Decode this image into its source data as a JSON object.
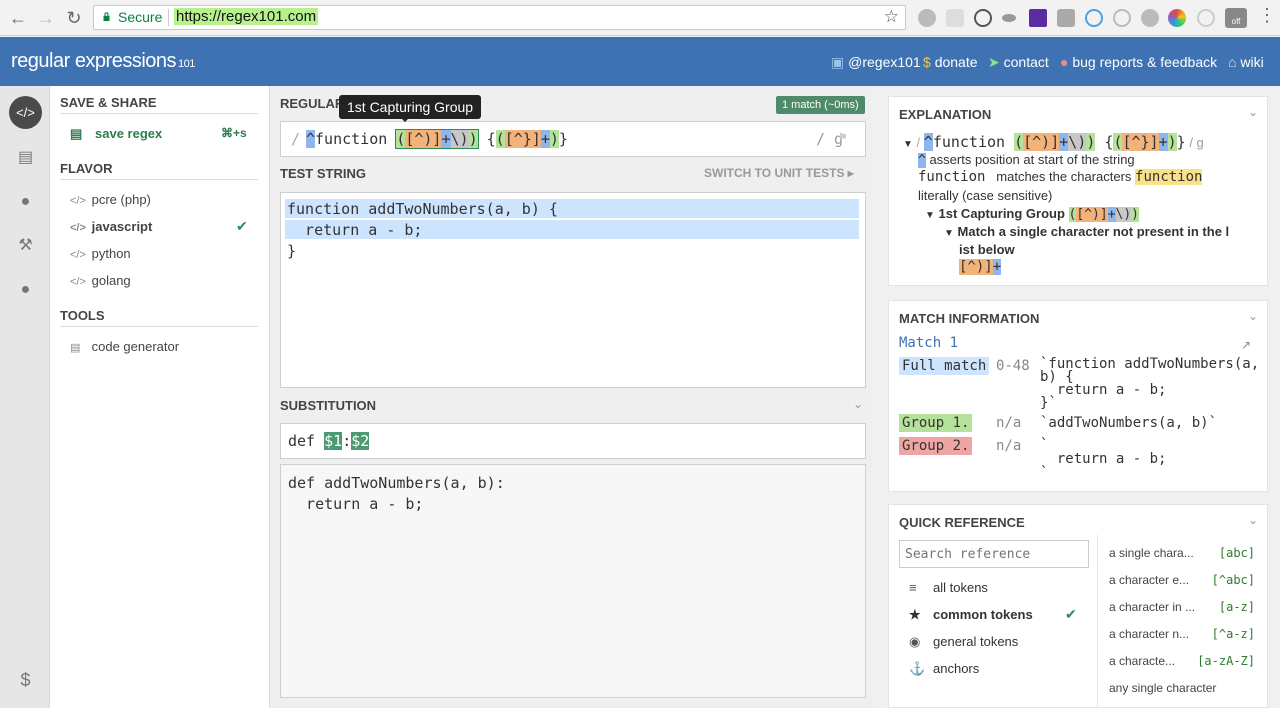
{
  "browser": {
    "secure_label": "Secure",
    "url": "https://regex101.com",
    "ext_off_label": "off"
  },
  "header": {
    "logo": "regular expressions",
    "logo_suffix": "101",
    "links": [
      "@regex101",
      "donate",
      "contact",
      "bug reports & feedback",
      "wiki"
    ]
  },
  "sidebar": {
    "save_share": "SAVE & SHARE",
    "save_regex": "save regex",
    "save_shortcut": "⌘+s",
    "flavor": "FLAVOR",
    "flavors": [
      "pcre (php)",
      "javascript",
      "python",
      "golang"
    ],
    "tools": "TOOLS",
    "code_generator": "code generator"
  },
  "regex": {
    "label": "REGULAR EXPRESSION",
    "tooltip": "1st Capturing Group",
    "match_badge": "1 match (~0ms)",
    "delimiter_open": "/",
    "flags": "/ g",
    "caret": "^",
    "literal": "function",
    "g1_open": "(",
    "cls": "[^)]",
    "plus": "+",
    "esc": "\\)",
    "g1_close": ")",
    "brace_open": "{",
    "g2_open": "(",
    "cls2": "[^}]",
    "plus2": "+",
    "g2_close": ")",
    "brace_close": "}"
  },
  "test": {
    "label": "TEST STRING",
    "unit_tests": "SWITCH TO UNIT TESTS",
    "lines": [
      "function addTwoNumbers(a, b) {",
      "  return a - b;",
      "}"
    ]
  },
  "subst": {
    "label": "SUBSTITUTION",
    "def": "def",
    "g1": "$1",
    "colon": ":",
    "g2": "$2",
    "result_lines": [
      "def addTwoNumbers(a, b):",
      "  return a - b;"
    ]
  },
  "explanation": {
    "title": "EXPLANATION",
    "top_flags": "/ g",
    "lines": {
      "caret_desc": "asserts position at start of the string",
      "function_token": "function",
      "function_desc": "matches the characters",
      "function_hl": "function",
      "literal_desc": "literally (case sensitive)",
      "group1": "1st Capturing Group",
      "match_single": "Match a single character not present in the l",
      "match_single2": "ist below",
      "cls_hl": "[^)]+"
    }
  },
  "match_info": {
    "title": "MATCH INFORMATION",
    "match_label": "Match 1",
    "rows": [
      {
        "name": "Full match",
        "range": "0-48",
        "value1": "`function addTwoNumbers(a,",
        "value2": "b) {",
        "value3": "  return a - b;",
        "value4": "}`"
      },
      {
        "name": "Group 1.",
        "range": "n/a",
        "value1": "`addTwoNumbers(a, b)`"
      },
      {
        "name": "Group 2.",
        "range": "n/a",
        "value1": "`",
        "value2": "  return a - b;",
        "value3": "`"
      }
    ]
  },
  "quick_ref": {
    "title": "QUICK REFERENCE",
    "search_placeholder": "Search reference",
    "categories": [
      "all tokens",
      "common tokens",
      "general tokens",
      "anchors"
    ],
    "refs": [
      {
        "desc": "a single chara...",
        "tok": "[abc]"
      },
      {
        "desc": "a character e...",
        "tok": "[^abc]"
      },
      {
        "desc": "a character in ...",
        "tok": "[a-z]"
      },
      {
        "desc": "a character n...",
        "tok": "[^a-z]"
      },
      {
        "desc": "a characte...",
        "tok": "[a-zA-Z]"
      },
      {
        "desc": "any single character",
        "tok": ""
      }
    ]
  },
  "colors": {
    "header": "#3e72b2",
    "green": "#2e8b57",
    "group1": "#b5e29a",
    "group2": "#f0a5a5",
    "class": "#f3b27a",
    "quant": "#8fb6ec"
  }
}
